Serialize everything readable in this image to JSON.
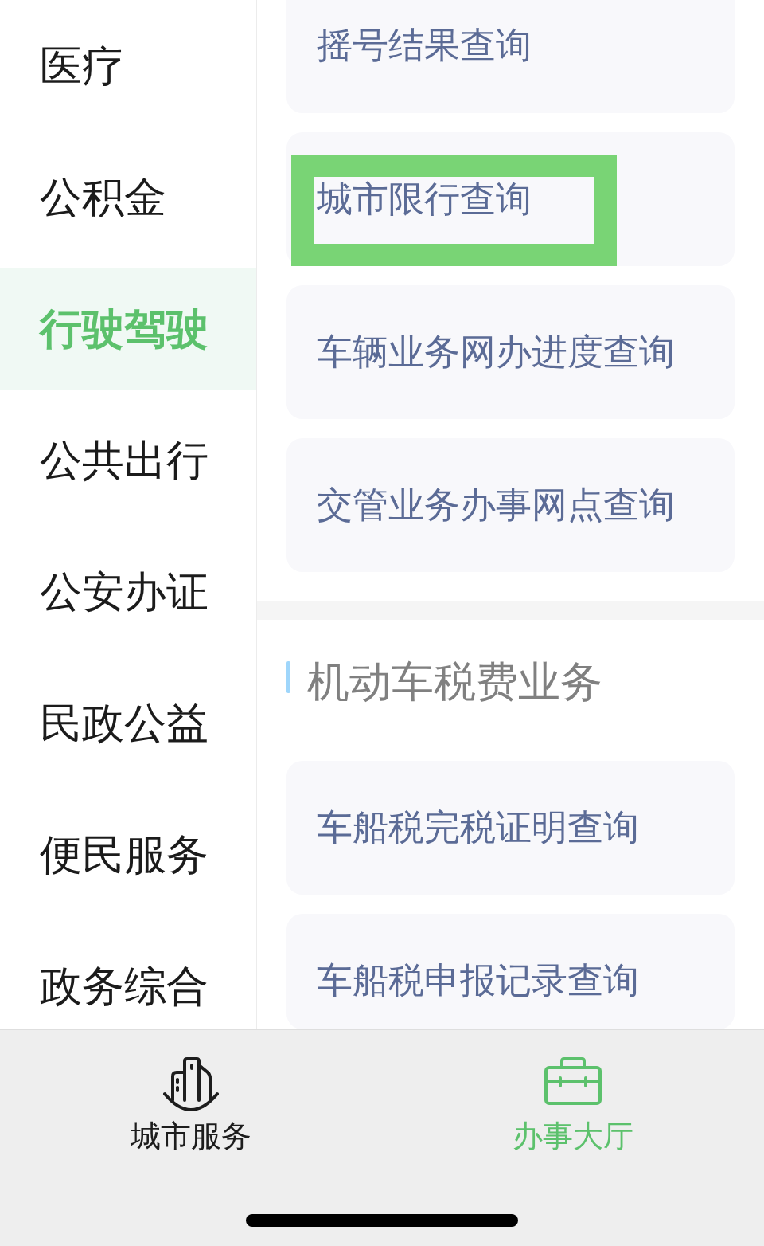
{
  "sidebar": {
    "items": [
      {
        "label": "医疗",
        "selected": false
      },
      {
        "label": "公积金",
        "selected": false
      },
      {
        "label": "行驶驾驶",
        "selected": true
      },
      {
        "label": "公共出行",
        "selected": false
      },
      {
        "label": "公安办证",
        "selected": false
      },
      {
        "label": "民政公益",
        "selected": false
      },
      {
        "label": "便民服务",
        "selected": false
      },
      {
        "label": "政务综合",
        "selected": false
      }
    ]
  },
  "sections": [
    {
      "cards": [
        {
          "label": "摇号结果查询",
          "highlighted": false
        },
        {
          "label": "城市限行查询",
          "highlighted": true
        },
        {
          "label": "车辆业务网办进度查询",
          "highlighted": false
        },
        {
          "label": "交管业务办事网点查询",
          "highlighted": false
        }
      ]
    },
    {
      "title": "机动车税费业务",
      "cards": [
        {
          "label": "车船税完税证明查询",
          "highlighted": false
        },
        {
          "label": "车船税申报记录查询",
          "highlighted": false
        }
      ]
    }
  ],
  "tab_bar": {
    "tabs": [
      {
        "label": "城市服务",
        "selected": false
      },
      {
        "label": "办事大厅",
        "selected": true
      }
    ]
  }
}
